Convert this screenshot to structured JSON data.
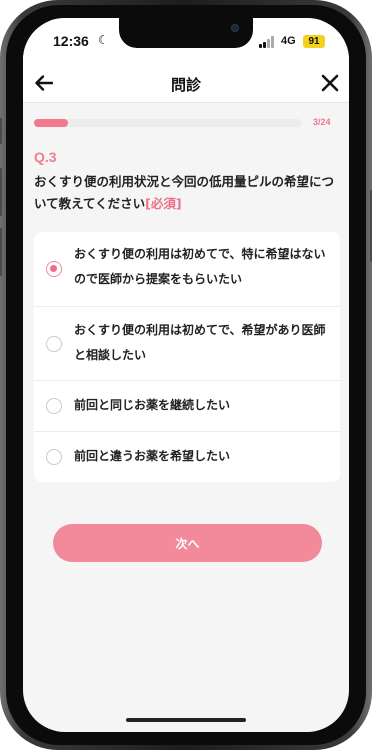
{
  "status_bar": {
    "time": "12:36",
    "network": "4G",
    "battery": "91"
  },
  "nav": {
    "title": "問診",
    "back_icon": "back-arrow-icon",
    "close_icon": "close-icon"
  },
  "progress": {
    "label": "3/24",
    "fraction": 0.125
  },
  "question": {
    "number": "Q.3",
    "text": "おくすり便の利用状況と今回の低用量ピルの希望について教えてください",
    "required": "[必須]"
  },
  "options": [
    {
      "label": "おくすり便の利用は初めてで、特に希望はないので医師から提案をもらいたい",
      "selected": true
    },
    {
      "label": "おくすり便の利用は初めてで、希望があり医師と相談したい",
      "selected": false
    },
    {
      "label": "前回と同じお薬を継続したい",
      "selected": false
    },
    {
      "label": "前回と違うお薬を希望したい",
      "selected": false
    }
  ],
  "next_button": {
    "label": "次へ"
  },
  "colors": {
    "accent": "#ef6f86",
    "button": "#f28a9c",
    "background": "#f5f5f5"
  }
}
